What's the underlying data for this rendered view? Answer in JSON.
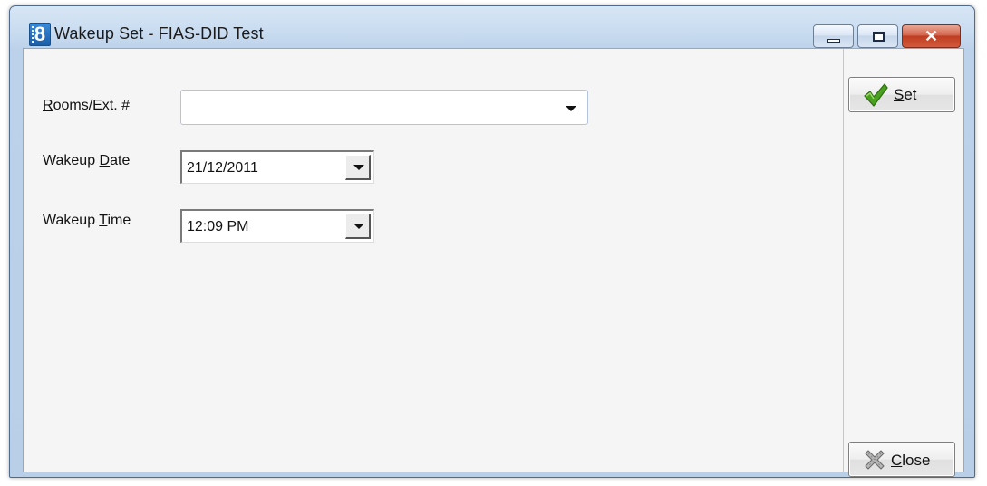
{
  "window": {
    "title": "Wakeup Set - FIAS-DID Test",
    "app_icon_glyph": "8",
    "controls": {
      "minimize": "minimize-icon",
      "maximize": "maximize-icon",
      "close_glyph": "✕"
    }
  },
  "form": {
    "room_label_prefix": "R",
    "room_label_rest": "ooms/Ext. #",
    "room_value": "",
    "date_label_prefix": "Wakeup ",
    "date_label_accel": "D",
    "date_label_rest": "ate",
    "date_value": "21/12/2011",
    "time_label_prefix": "Wakeup ",
    "time_label_accel": "T",
    "time_label_rest": "ime",
    "time_value": "12:09 PM"
  },
  "actions": {
    "set_accel": "S",
    "set_rest": "et",
    "close_accel": "C",
    "close_rest": "lose"
  },
  "colors": {
    "check": "#4aa01f",
    "close_x": "#8a8a8a",
    "title_close": "#c8452a"
  }
}
